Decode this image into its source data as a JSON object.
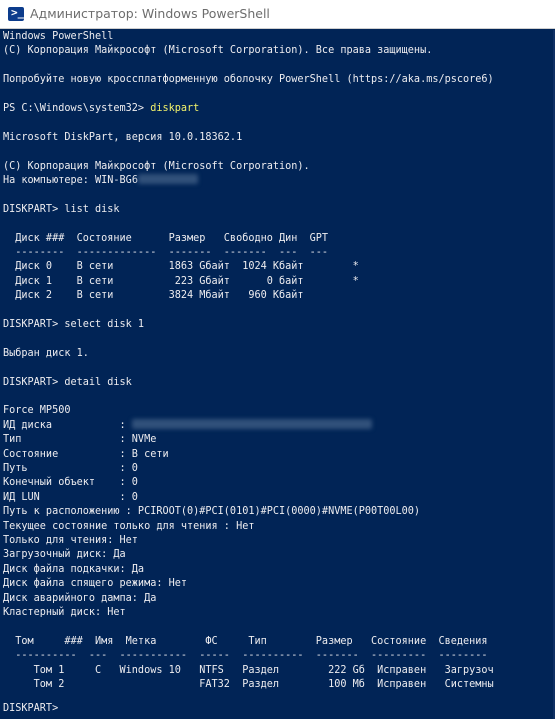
{
  "window": {
    "title": "Администратор: Windows PowerShell",
    "icon": "powershell-icon",
    "icon_glyph": ">_"
  },
  "colors": {
    "background": "#012456",
    "text": "#eeedf0",
    "command": "#f3f36b",
    "titlebar_bg": "#ffffff",
    "titlebar_text": "#6d6d6d"
  },
  "console": {
    "header_l1": "Windows PowerShell",
    "header_l2": "(C) Корпорация Майкрософт (Microsoft Corporation). Все права защищены.",
    "header_l3": "Попробуйте новую кроссплатформенную оболочку PowerShell (https://aka.ms/pscore6)",
    "ps_prompt": "PS C:\\Windows\\system32> ",
    "ps_command": "diskpart",
    "dp_version": "Microsoft DiskPart, версия 10.0.18362.1",
    "dp_copyright": "(C) Корпорация Майкрософт (Microsoft Corporation).",
    "computer_label": "На компьютере: ",
    "computer_name_visible": "WIN-BG6",
    "prompt_list_disk": "DISKPART> list disk",
    "disk_table_header": "  Диск ###  Состояние      Размер   Свободно Дин  GPT",
    "disk_table_sep": "  --------  -------------  -------  -------  ---  ---",
    "disk_rows": [
      "  Диск 0    В сети         1863 Gбайт  1024 Кбайт        *",
      "  Диск 1    В сети          223 Gбайт      0 байт        *",
      "  Диск 2    В сети         3824 Мбайт   960 Кбайт"
    ],
    "prompt_select_disk": "DISKPART> select disk 1",
    "selected_msg": "Выбран диск 1.",
    "prompt_detail_disk": "DISKPART> detail disk",
    "model": "Force MP500",
    "disk_id_label": "ИД диска           : ",
    "props": [
      "Тип                : NVMe",
      "Состояние          : В сети",
      "Путь               : 0",
      "Конечный объект    : 0",
      "ИД LUN             : 0",
      "Путь к расположению : PCIROOT(0)#PCI(0101)#PCI(0000)#NVME(P00T00L00)",
      "Текущее состояние только для чтения : Нет",
      "Только для чтения: Нет",
      "Загрузочный диск: Да",
      "Диск файла подкачки: Да",
      "Диск файла спящего режима: Нет",
      "Диск аварийного дампа: Да",
      "Кластерный диск: Нет"
    ],
    "volume_table_header": "  Том     ###  Имя  Метка        ФС     Тип        Размер   Состояние  Сведения",
    "volume_table_sep": "  ----------  ---  -----------  -----  ----------  -------  ---------  --------",
    "volume_rows": [
      "     Том 1     C   Windows 10   NTFS   Раздел        222 Gб  Исправен   Загрузоч",
      "     Том 2                      FAT32  Раздел        100 Мб  Исправен   Системны"
    ],
    "final_prompt": "DISKPART>"
  }
}
